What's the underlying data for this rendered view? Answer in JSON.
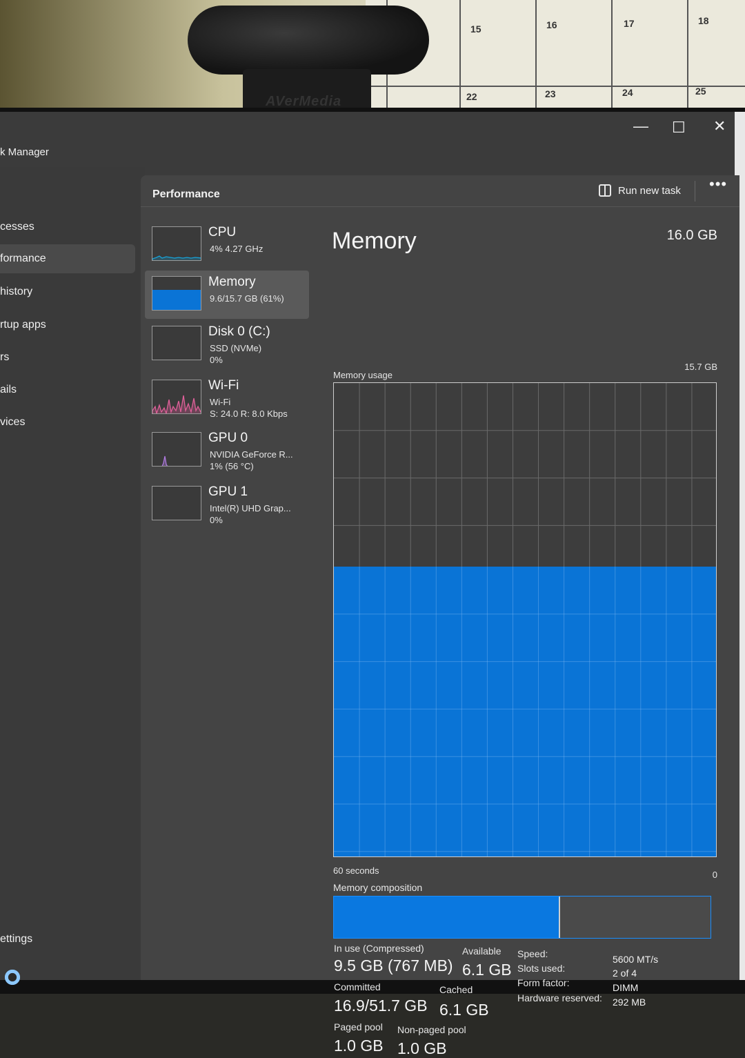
{
  "scene": {
    "webcam_brand": "AVerMedia",
    "calendar_numbers": [
      "15",
      "16",
      "17",
      "18",
      "22",
      "23",
      "24",
      "25"
    ]
  },
  "window": {
    "title": "k Manager",
    "minimize": "—",
    "maximize": "☐",
    "close": "✕"
  },
  "nav": {
    "items": [
      {
        "label": "cesses"
      },
      {
        "label": "formance"
      },
      {
        "label": "history"
      },
      {
        "label": "rtup apps"
      },
      {
        "label": "rs"
      },
      {
        "label": "ails"
      },
      {
        "label": "vices"
      }
    ],
    "settings": "ettings"
  },
  "header": {
    "title": "Performance",
    "run_new_task": "Run new task",
    "more": "•••"
  },
  "resources": [
    {
      "name": "CPU",
      "line1": "4% 4.27 GHz",
      "line2": ""
    },
    {
      "name": "Memory",
      "line1": "9.6/15.7 GB (61%)",
      "line2": ""
    },
    {
      "name": "Disk 0 (C:)",
      "line1": "SSD (NVMe)",
      "line2": "0%"
    },
    {
      "name": "Wi-Fi",
      "line1": "Wi-Fi",
      "line2": "S: 24.0 R: 8.0 Kbps"
    },
    {
      "name": "GPU 0",
      "line1": "NVIDIA GeForce R...",
      "line2": "1% (56 °C)"
    },
    {
      "name": "GPU 1",
      "line1": "Intel(R) UHD Grap...",
      "line2": "0%"
    }
  ],
  "memory": {
    "title": "Memory",
    "total": "16.0 GB",
    "usable": "15.7 GB",
    "usage_label": "Memory usage",
    "time_label": "60 seconds",
    "zero_label": "0",
    "composition_label": "Memory composition",
    "usage_fraction": 0.61,
    "in_use_fraction": 0.6,
    "stats": {
      "in_use_label": "In use (Compressed)",
      "in_use_value": "9.5 GB (767 MB)",
      "available_label": "Available",
      "available_value": "6.1 GB",
      "committed_label": "Committed",
      "committed_value": "16.9/51.7 GB",
      "cached_label": "Cached",
      "cached_value": "6.1 GB",
      "paged_label": "Paged pool",
      "paged_value": "1.0 GB",
      "nonpaged_label": "Non-paged pool",
      "nonpaged_value": "1.0 GB"
    },
    "specs": [
      {
        "label": "Speed:",
        "value": "5600 MT/s"
      },
      {
        "label": "Slots used:",
        "value": "2 of 4"
      },
      {
        "label": "Form factor:",
        "value": "DIMM"
      },
      {
        "label": "Hardware reserved:",
        "value": "292 MB"
      }
    ]
  },
  "colors": {
    "accent": "#0a74d6",
    "cpu_line": "#17a2d8",
    "wifi_line": "#e0609a",
    "gpu_line": "#b07be0"
  }
}
